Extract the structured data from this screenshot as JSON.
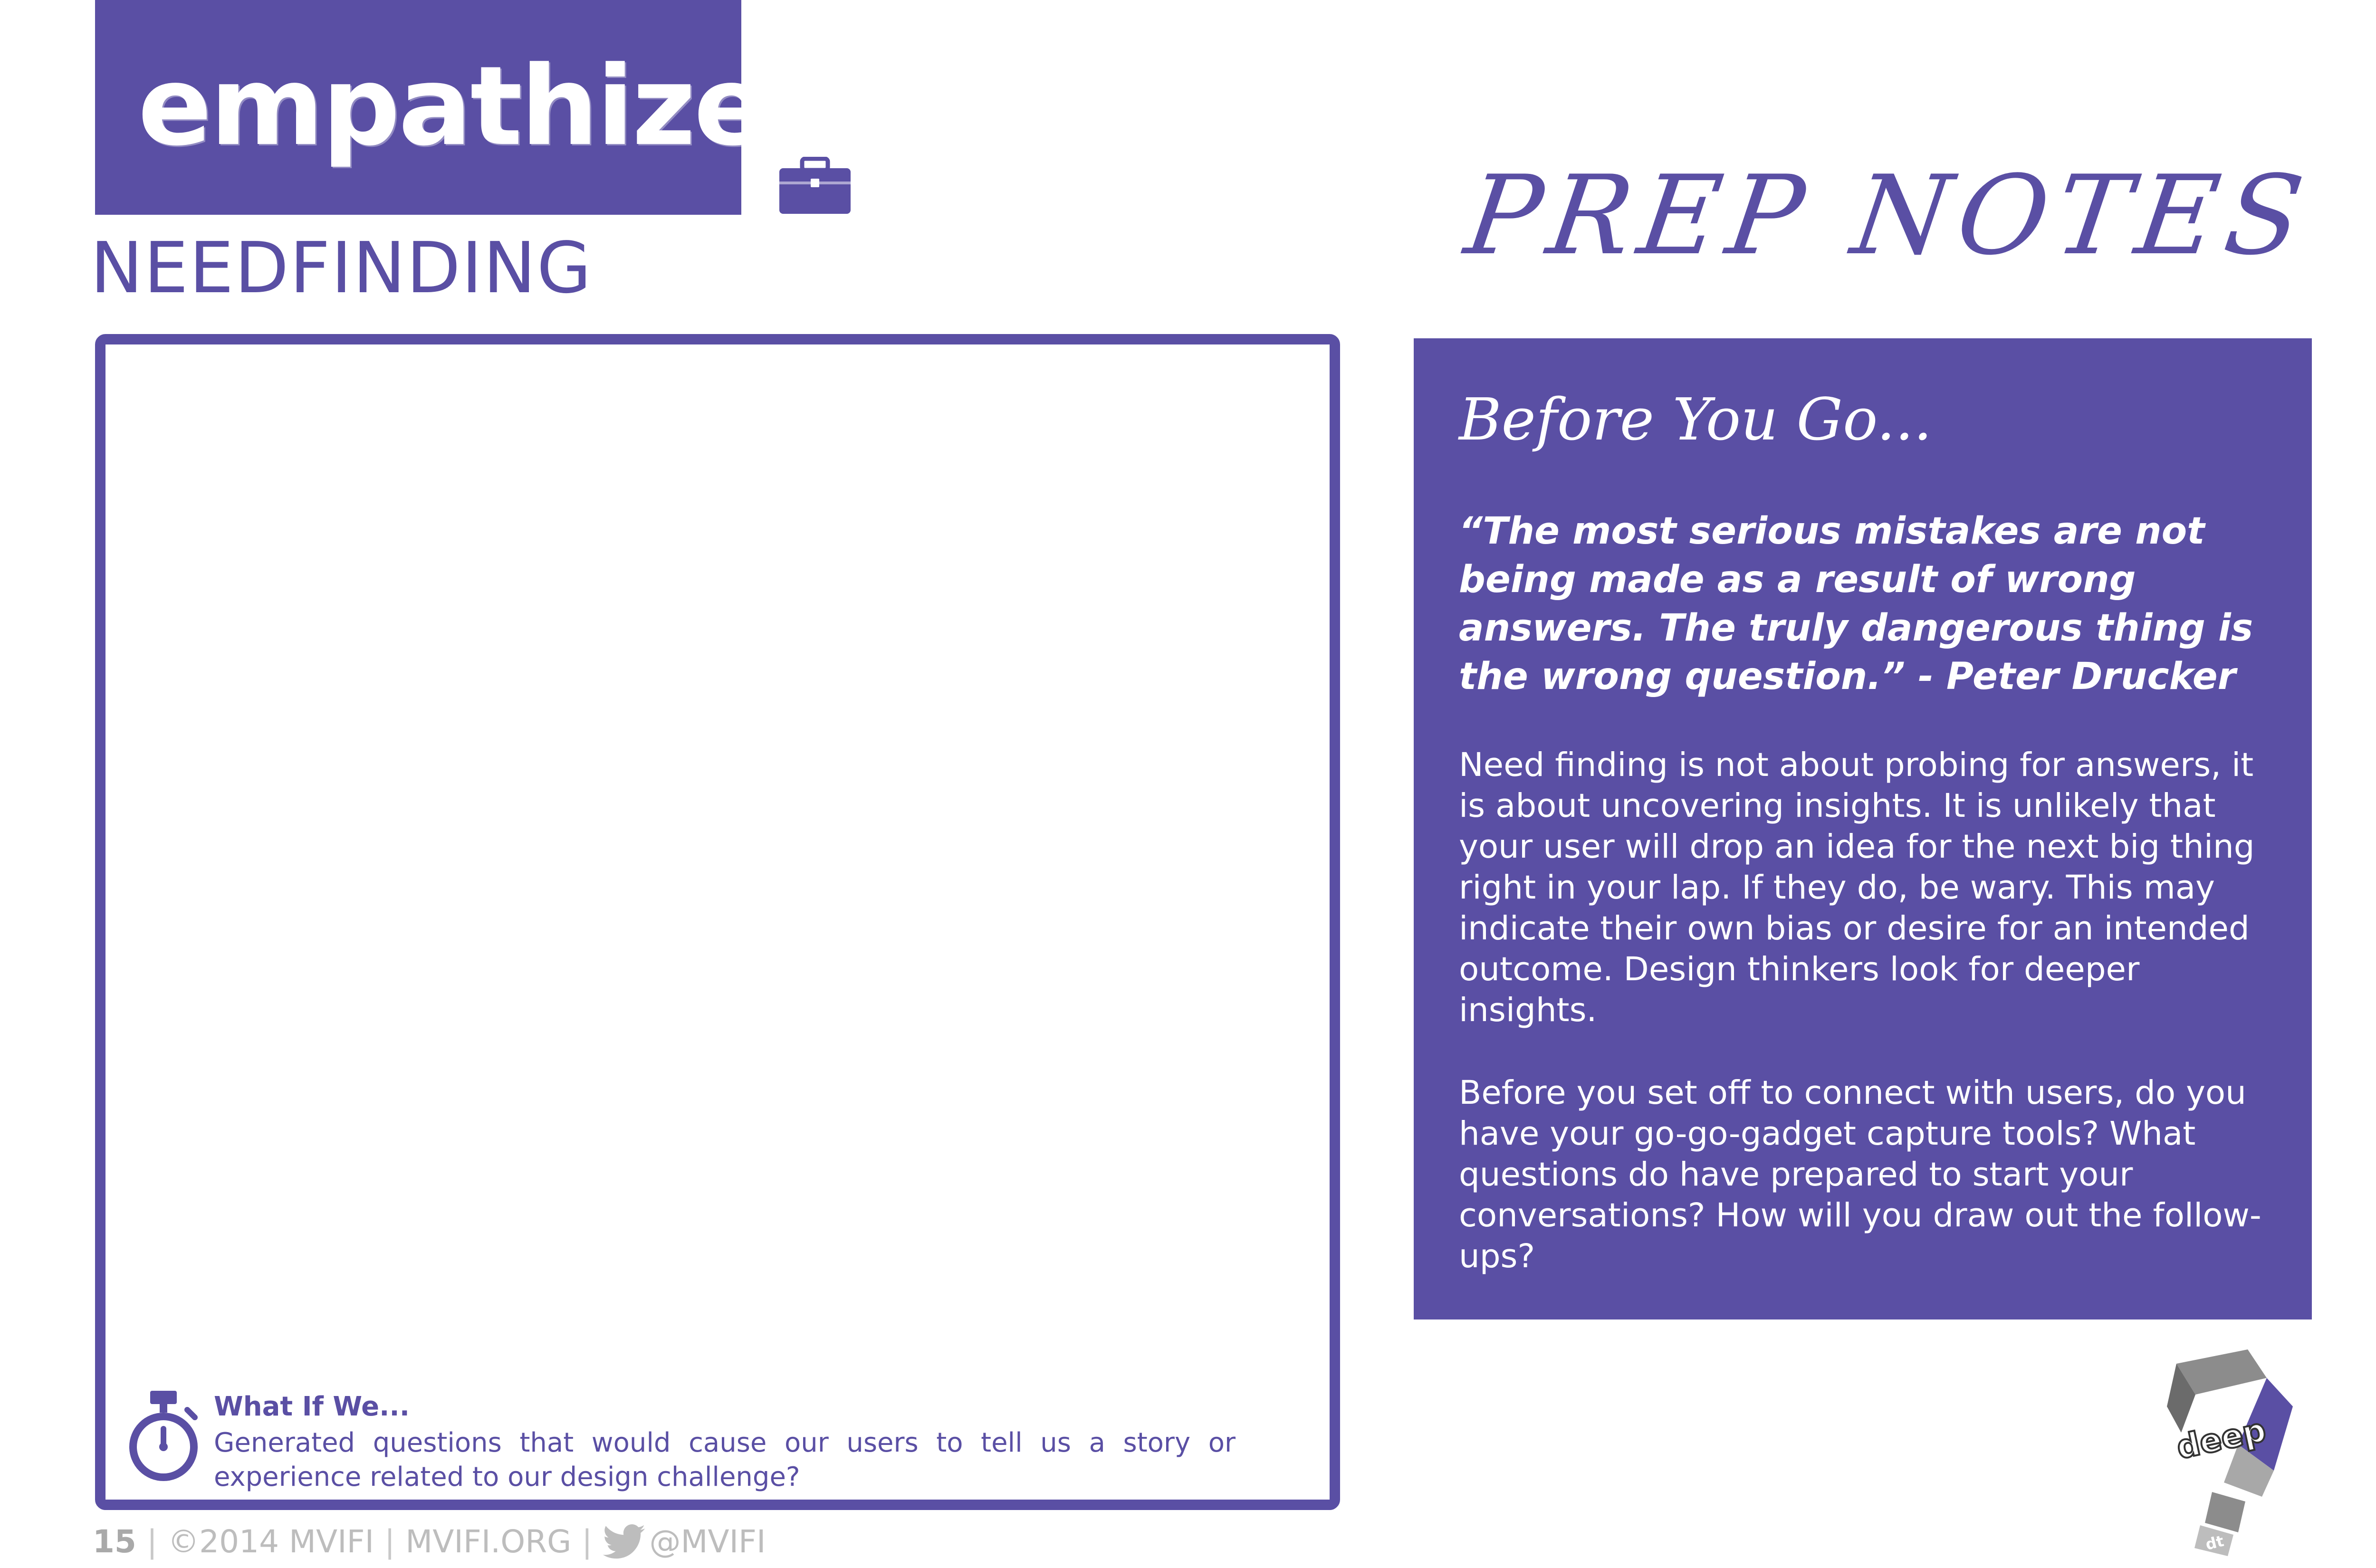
{
  "header": {
    "banner_title": "empathize",
    "subtitle": "NEEDFINDING",
    "prep_notes_title": "PREP NOTES"
  },
  "notes_box": {
    "tip_title": "What If We...",
    "tip_body": "Generated questions that would cause our users to tell us a story or experience related to our design challenge?"
  },
  "prep_panel": {
    "heading": "Before You Go...",
    "quote": "“The most serious mistakes are not being made as a result of wrong answers. The truly dangerous thing is the wrong question.” - Peter Drucker",
    "paragraph_1": "Need finding is not about probing for answers, it is about uncovering insights. It is unlikely that your user will drop an idea for the next big thing right in your lap. If they do, be wary. This may indicate their own bias or desire for an intended outcome. Design thinkers look for deeper insights.",
    "paragraph_2": "Before you set off to connect with users, do you have your go-go-gadget capture tools? What questions do have prepared to start your conversations? How will you draw out the follow-ups?"
  },
  "logo": {
    "word": "deep",
    "sub": "dt"
  },
  "footer": {
    "page_number": "15",
    "separator": "|",
    "copyright": "©2014 MVIFI",
    "website": "MVIFI.ORG",
    "handle": "@MVIFI"
  },
  "icons": {
    "briefcase": "briefcase-icon",
    "stopwatch": "stopwatch-icon",
    "twitter": "twitter-bird-icon"
  },
  "colors": {
    "brand_purple": "#5a4fa4",
    "footer_gray": "#bdbdbd"
  }
}
